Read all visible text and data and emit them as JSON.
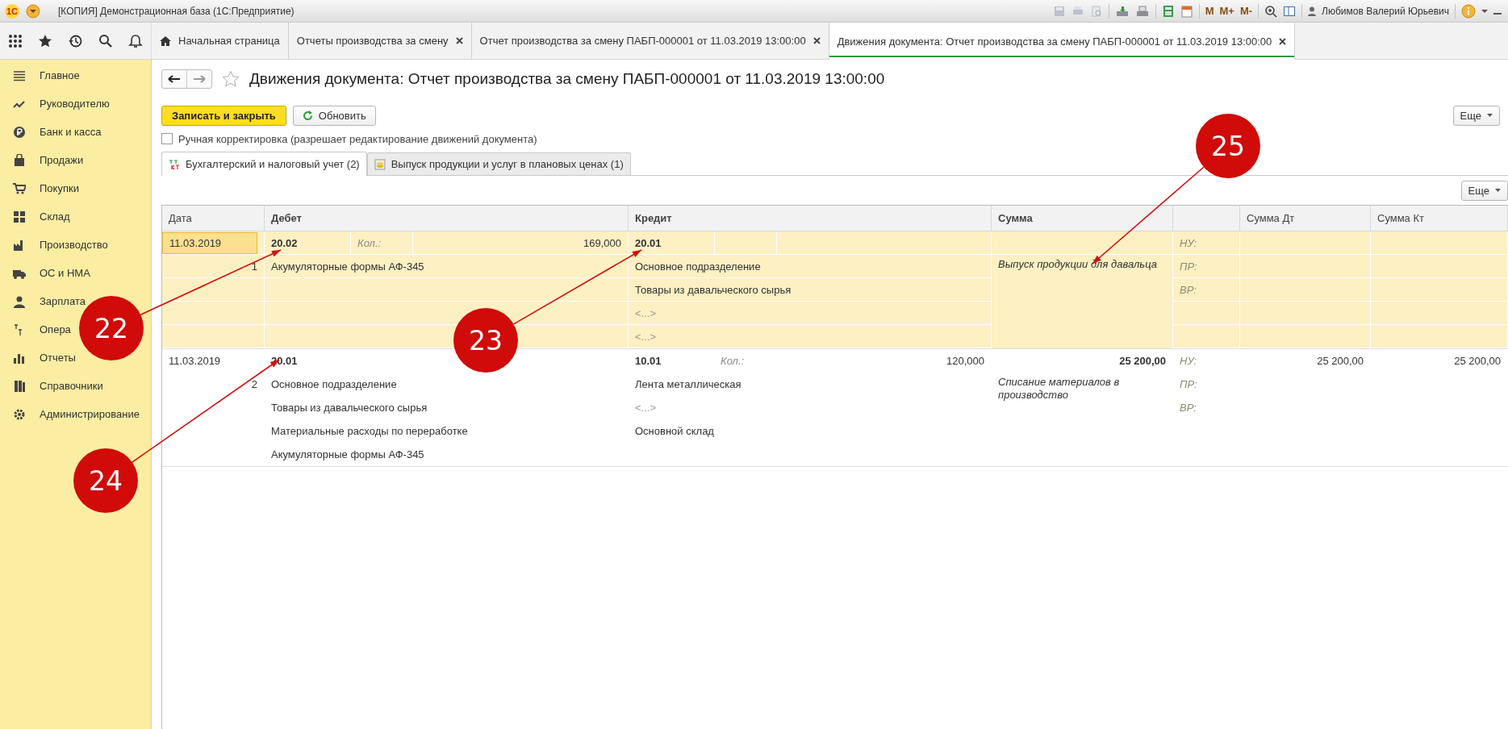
{
  "window": {
    "logo": "1С",
    "title": "[КОПИЯ] Демонстрационная база  (1С:Предприятие)",
    "memory_buttons": [
      "M",
      "M+",
      "M-"
    ],
    "user": "Любимов Валерий Юрьевич"
  },
  "open_tabs": [
    {
      "label": "Начальная страница",
      "kind": "home",
      "selected": false
    },
    {
      "label": "Отчеты производства за смену",
      "kind": "document",
      "selected": false
    },
    {
      "label": "Отчет производства за смену ПАБП-000001 от 11.03.2019 13:00:00",
      "kind": "document",
      "selected": false
    },
    {
      "label": "Движения документа: Отчет производства за смену ПАБП-000001 от 11.03.2019 13:00:00",
      "kind": "document",
      "selected": true
    }
  ],
  "sidebar": {
    "items": [
      {
        "label": "Главное"
      },
      {
        "label": "Руководителю"
      },
      {
        "label": "Банк и касса"
      },
      {
        "label": "Продажи"
      },
      {
        "label": "Покупки"
      },
      {
        "label": "Склад"
      },
      {
        "label": "Производство"
      },
      {
        "label": "ОС и НМА"
      },
      {
        "label": "Зарплата"
      },
      {
        "label": "Опера"
      },
      {
        "label": "Отчеты"
      },
      {
        "label": "Справочники"
      },
      {
        "label": "Администрирование"
      }
    ]
  },
  "page_title": "Движения документа: Отчет производства за смену ПАБП-000001 от 11.03.2019 13:00:00",
  "buttons": {
    "save": "Записать и закрыть",
    "refresh": "Обновить",
    "more": "Еще"
  },
  "manual_edit": {
    "label": "Ручная корректировка (разрешает редактирование движений документа)",
    "checked": false
  },
  "register_tabs": [
    {
      "label": "Бухгалтерский и налоговый учет (2)",
      "selected": true
    },
    {
      "label": "Выпуск продукции и услуг в плановых ценах (1)",
      "selected": false
    }
  ],
  "table": {
    "more": "Еще",
    "columns": [
      "Дата",
      "Дебет",
      "Кредит",
      "Сумма",
      "",
      "Сумма Дт",
      "Сумма Кт"
    ],
    "rows": [
      {
        "selected": true,
        "date": "11.03.2019",
        "number": "1",
        "debit": {
          "account": "20.02",
          "qty_label": "Кол.:",
          "qty": "169,000",
          "subconto": [
            {
              "text": "Акумуляторные формы АФ-345",
              "empty": false
            }
          ]
        },
        "credit": {
          "account": "20.01",
          "subconto": [
            {
              "text": "Основное подразделение",
              "empty": false
            },
            {
              "text": "Товары из давальческого сырья",
              "empty": false
            },
            {
              "text": "<...>",
              "empty": true
            },
            {
              "text": "<...>",
              "empty": true
            }
          ]
        },
        "sum": "",
        "comment": "Выпуск продукции для давальца",
        "tax_labels": [
          "НУ:",
          "ПР:",
          "ВР:"
        ],
        "sum_dt": "",
        "sum_kt": ""
      },
      {
        "selected": false,
        "date": "11.03.2019",
        "number": "2",
        "debit": {
          "account": "20.01",
          "subconto": [
            {
              "text": "Основное подразделение",
              "empty": false
            },
            {
              "text": "Товары из давальческого сырья",
              "empty": false
            },
            {
              "text": "Материальные расходы по переработке",
              "empty": false
            },
            {
              "text": "Акумуляторные формы АФ-345",
              "empty": false
            }
          ]
        },
        "credit": {
          "account": "10.01",
          "qty_label": "Кол.:",
          "qty": "120,000",
          "subconto": [
            {
              "text": "Лента металлическая",
              "empty": false
            },
            {
              "text": "<...>",
              "empty": true
            },
            {
              "text": "Основной склад",
              "empty": false
            }
          ]
        },
        "sum": "25 200,00",
        "comment": "Списание материалов в производство",
        "tax_labels": [
          "НУ:",
          "ПР:",
          "ВР:"
        ],
        "sum_dt": "25 200,00",
        "sum_kt": "25 200,00"
      }
    ]
  },
  "callouts": [
    {
      "label": "22"
    },
    {
      "label": "23"
    },
    {
      "label": "24"
    },
    {
      "label": "25"
    }
  ]
}
